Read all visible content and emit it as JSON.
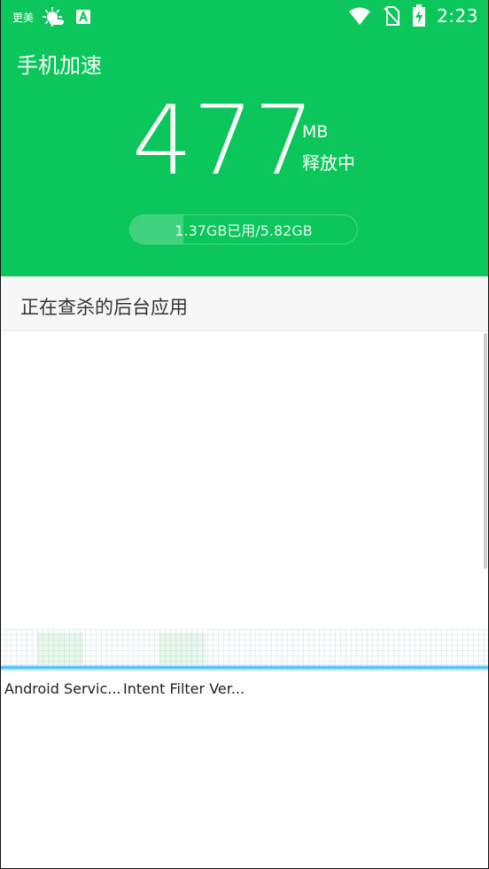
{
  "status_bar": {
    "left_text": "更美",
    "time": "2:23",
    "icons": [
      "weather-icon",
      "app-a-icon",
      "wifi-icon",
      "no-sim-icon",
      "battery-charging-icon"
    ]
  },
  "header": {
    "title": "手机加速",
    "amount": "477",
    "unit": "MB",
    "status": "释放中",
    "memory_text": "1.37GB已用/5.82GB",
    "memory_used_fraction": 0.235
  },
  "section": {
    "title": "正在查杀的后台应用"
  },
  "apps": [
    {
      "name": "Android Servic..."
    },
    {
      "name": "Intent Filter Ver..."
    }
  ],
  "colors": {
    "primary": "#0bc65a",
    "scan_line": "#2fb5ec",
    "section_bg": "#f7f7f7"
  }
}
